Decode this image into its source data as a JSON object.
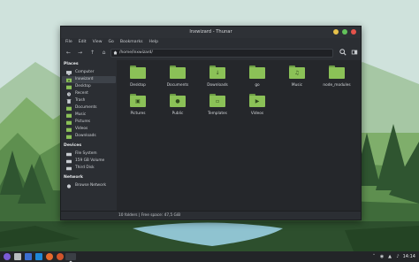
{
  "window": {
    "title": "lnxwizard - Thunar",
    "buttons": {
      "minimize_color": "#e6c14a",
      "maximize_color": "#62c25b",
      "close_color": "#e5534b"
    }
  },
  "menubar": [
    "File",
    "Edit",
    "View",
    "Go",
    "Bookmarks",
    "Help"
  ],
  "toolbar": {
    "path": "/home/lnxwizard/"
  },
  "sidebar": {
    "places_label": "Places",
    "places": [
      "Computer",
      "lnxwizard",
      "Desktop",
      "Recent",
      "Trash",
      "Documents",
      "Music",
      "Pictures",
      "Videos",
      "Downloads"
    ],
    "devices_label": "Devices",
    "devices": [
      "File System",
      "159 GB Volume",
      "Third Disk"
    ],
    "network_label": "Network",
    "network": [
      "Browse Network"
    ]
  },
  "files": [
    {
      "name": "Desktop",
      "icon": "folder-icon"
    },
    {
      "name": "Documents",
      "icon": "folder-icon"
    },
    {
      "name": "Downloads",
      "icon": "download-folder-icon"
    },
    {
      "name": "go",
      "icon": "folder-icon"
    },
    {
      "name": "Music",
      "icon": "music-folder-icon"
    },
    {
      "name": "node_modules",
      "icon": "folder-icon"
    },
    {
      "name": "Pictures",
      "icon": "pictures-folder-icon"
    },
    {
      "name": "Public",
      "icon": "public-folder-icon"
    },
    {
      "name": "Templates",
      "icon": "templates-folder-icon"
    },
    {
      "name": "Videos",
      "icon": "videos-folder-icon"
    }
  ],
  "status": "10 folders  |  Free space: 47,5 GiB",
  "taskbar": {
    "clock": "14:14"
  },
  "colors": {
    "accent_folder": "#8bc157",
    "window_bg": "#2b2e33",
    "file_area_bg": "#25272b"
  }
}
